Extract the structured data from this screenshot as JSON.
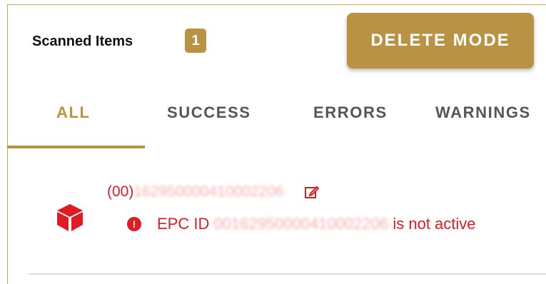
{
  "header": {
    "title": "Scanned Items",
    "count": "1",
    "delete_mode_label": "DELETE MODE"
  },
  "tabs": [
    {
      "label": "ALL",
      "active": true
    },
    {
      "label": "SUCCESS",
      "active": false
    },
    {
      "label": "ERRORS",
      "active": false
    },
    {
      "label": "WARNINGS",
      "active": false
    }
  ],
  "items": [
    {
      "gtin_prefix": "(00)",
      "gtin_obscured": "162950000410002206",
      "error_prefix": "EPC ID",
      "error_obscured": "00162950000410002206",
      "error_suffix": "is not active"
    }
  ],
  "icons": {
    "item": "box-icon",
    "edit": "edit-icon",
    "error": "error-icon"
  },
  "colors": {
    "accent": "#b99343",
    "error": "#e11b22",
    "tab_inactive": "#555555"
  }
}
